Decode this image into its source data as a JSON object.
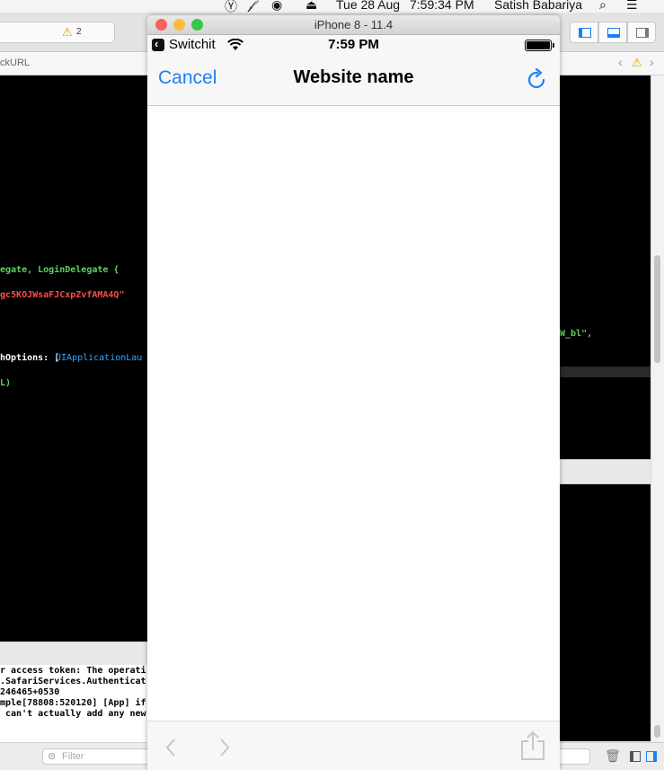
{
  "menubar": {
    "date": "Tue 28 Aug",
    "time": "7:59:34 PM",
    "user": "Satish Babariya"
  },
  "xcode": {
    "warning_count": "2",
    "jumpbar_text": "ckURL",
    "code_lines": [
      {
        "text": "egate, LoginDelegate {",
        "color": "#5dd35d"
      },
      {
        "text": "gc5KOJWsaFJCxpZvfAMA4Q\"",
        "color": "#ff4c4c"
      },
      {
        "text": "hOptions: [",
        "color": "#ffffff"
      },
      {
        "text": "UIApplicationLau",
        "color": "#35a7ff"
      },
      {
        "text": "L)",
        "color": "#5dd35d"
      }
    ],
    "right_code": "W_bl\",",
    "console_lines": [
      "r access token: The operati",
      ".SafariServices.Authenticat",
      "246465+0530",
      "mple[78808:520120] [App] if",
      " can't actually add any new"
    ],
    "filter_placeholder": "Filter"
  },
  "simulator": {
    "window_title": "iPhone 8 - 11.4",
    "status": {
      "back_app": "Switchit",
      "time": "7:59 PM"
    },
    "nav": {
      "cancel_label": "Cancel",
      "title": "Website name"
    },
    "colors": {
      "accent": "#1a7ff5",
      "close": "#fc605c",
      "minimize": "#fdbc40",
      "zoom": "#34c84a"
    }
  }
}
